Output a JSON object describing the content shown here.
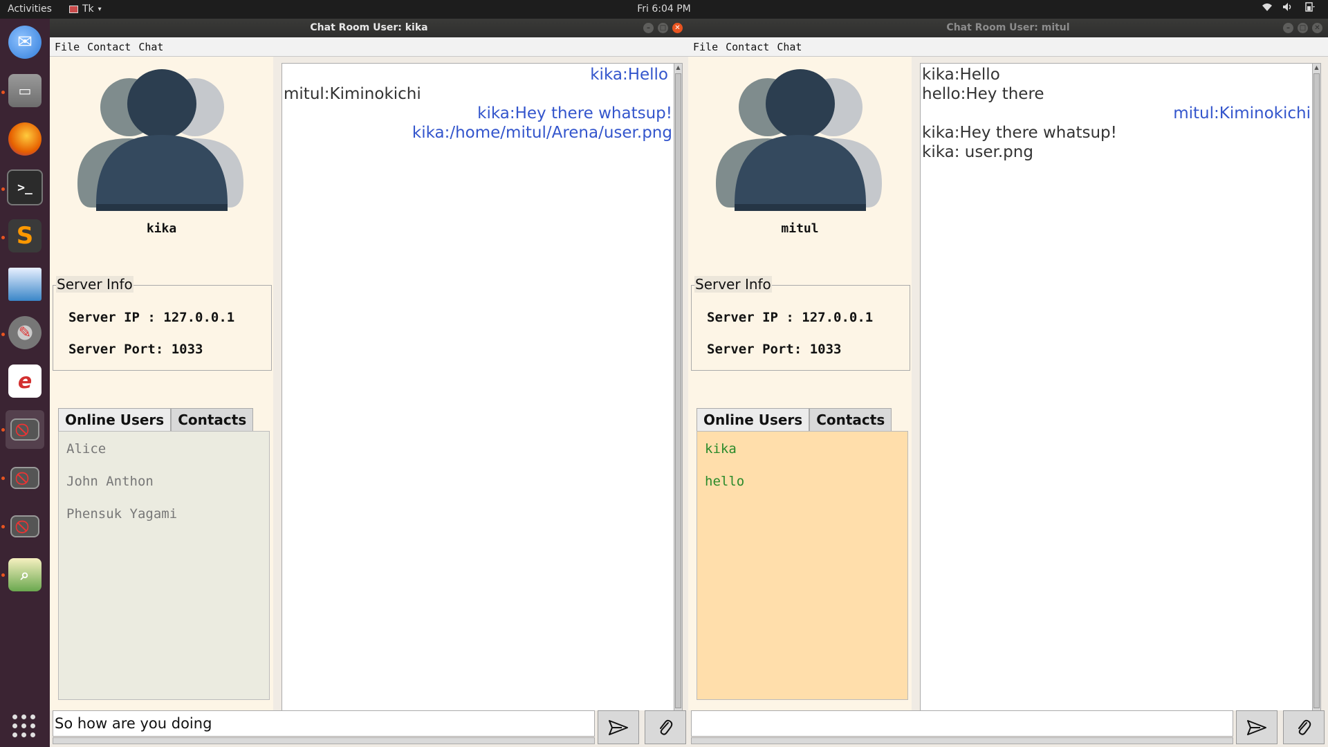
{
  "topbar": {
    "activities": "Activities",
    "app_name": "Tk",
    "clock": "Fri  6:04 PM",
    "tray": [
      "wifi-icon",
      "volume-icon",
      "battery-icon"
    ]
  },
  "dock": {
    "items": [
      {
        "name": "thunderbird-icon",
        "color": "#2f7bd9"
      },
      {
        "name": "files-icon",
        "color": "#8c8c8c"
      },
      {
        "name": "firefox-icon",
        "color": "#e66000"
      },
      {
        "name": "terminal-icon",
        "color": "#2b2b2b"
      },
      {
        "name": "sublime-text-icon",
        "color": "#ff9800"
      },
      {
        "name": "image-viewer-icon",
        "color": "#3a86c8"
      },
      {
        "name": "settings-icon",
        "color": "#777777"
      },
      {
        "name": "rhythmbox-icon",
        "color": "#d32f2f"
      },
      {
        "name": "tk-window-icon",
        "color": "#555555"
      },
      {
        "name": "tk-window-icon",
        "color": "#555555"
      },
      {
        "name": "tk-window-icon",
        "color": "#555555"
      },
      {
        "name": "image-search-icon",
        "color": "#6aa84f"
      }
    ]
  },
  "windows": [
    {
      "title": "Chat Room User: kika",
      "menu": [
        "File",
        "Contact",
        "Chat"
      ],
      "username": "kika",
      "server_info": {
        "legend": "Server Info",
        "ip_row": "Server IP : 127.0.0.1",
        "port_row": "Server Port: 1033"
      },
      "tabs": [
        "Online Users",
        "Contacts"
      ],
      "users": [
        "Alice",
        "John Anthon",
        "Phensuk Yagami"
      ],
      "messages": [
        {
          "text": "kika:Hello",
          "align": "right"
        },
        {
          "text": "mitul:Kiminokichi",
          "align": "left"
        },
        {
          "text": "kika:Hey there whatsup!",
          "align": "right"
        },
        {
          "text": "kika:/home/mitul/Arena/user.png",
          "align": "right"
        }
      ],
      "input_value": "So how are you doing"
    },
    {
      "title": "Chat Room User: mitul",
      "menu": [
        "File",
        "Contact",
        "Chat"
      ],
      "username": "mitul",
      "server_info": {
        "legend": "Server Info",
        "ip_row": "Server IP : 127.0.0.1",
        "port_row": "Server Port: 1033"
      },
      "tabs": [
        "Online Users",
        "Contacts"
      ],
      "users": [
        "kika",
        "hello"
      ],
      "messages": [
        {
          "text": "kika:Hello",
          "align": "left"
        },
        {
          "text": "hello:Hey there",
          "align": "left"
        },
        {
          "text": "mitul:Kiminokichi",
          "align": "right"
        },
        {
          "text": "kika:Hey there whatsup!",
          "align": "left"
        },
        {
          "text": "kika: user.png",
          "align": "left"
        }
      ],
      "input_value": ""
    }
  ],
  "colors": {
    "own_message": "#3355cc",
    "other_message": "#333333",
    "online_user_kika_window": "#777777",
    "online_user_mitul_window": "#2a8a2a",
    "user_list_bg_mitul": "#ffdeab"
  }
}
